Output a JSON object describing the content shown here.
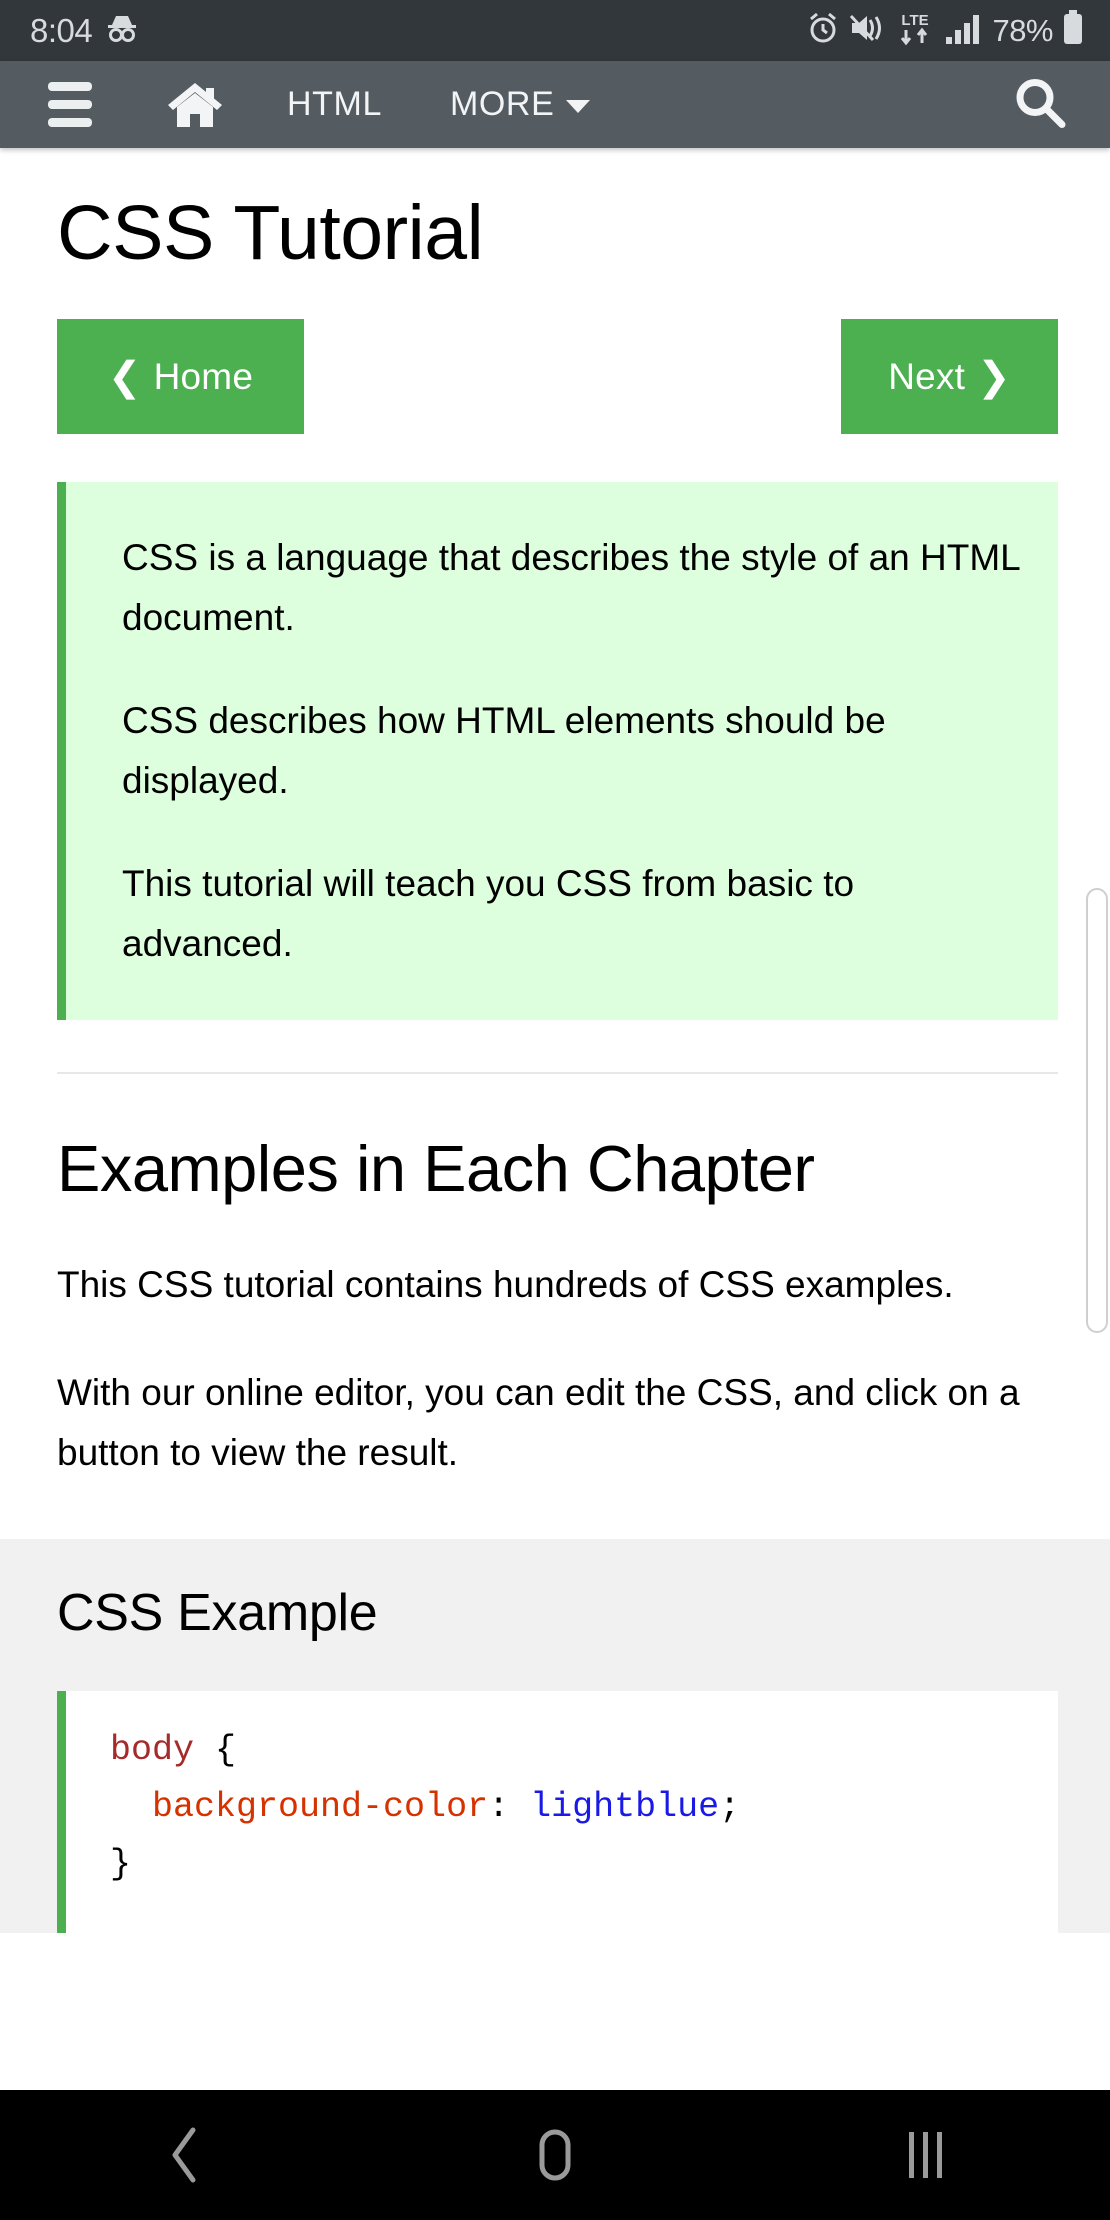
{
  "status_bar": {
    "clock": "8:04",
    "battery_percent": "78%",
    "icons": [
      "incognito-icon",
      "alarm-icon",
      "mute-vibrate-icon",
      "lte-data-icon",
      "signal-bars-icon",
      "battery-icon"
    ],
    "background_color": "#32373b",
    "text_color": "#d8dbdd"
  },
  "topnav": {
    "menu_label": "menu",
    "home_label": "home",
    "html_label": "HTML",
    "more_label": "MORE",
    "search_label": "search",
    "background_color": "#555c61",
    "text_color": "#f2f4f5"
  },
  "page": {
    "title": "CSS Tutorial",
    "prev_button": "Home",
    "prev_chevron": "❮",
    "next_button": "Next",
    "next_chevron": "❯",
    "accent_color": "#4CAF50",
    "notice_background": "#ddffdd",
    "notice_paragraphs": [
      "CSS is a language that describes the style of an HTML document.",
      "CSS describes how HTML elements should be displayed.",
      "This tutorial will teach you CSS from basic to advanced."
    ],
    "section_heading": "Examples in Each Chapter",
    "body_paragraphs": [
      "This CSS tutorial contains hundreds of CSS examples.",
      "With our online editor, you can edit the CSS, and click on a button to view the result."
    ],
    "example_title": "CSS Example",
    "example_panel_background": "#f1f1f1",
    "code": {
      "selector": "body",
      "open_brace": " {",
      "property": "background-color",
      "colon": ": ",
      "value": "lightblue",
      "semicolon": ";",
      "close_brace": "}",
      "selector_color": "#a52a2a",
      "property_color": "#d63200",
      "value_color": "#1a1ae6"
    }
  },
  "android_nav": {
    "back_label": "back",
    "home_label": "home",
    "recents_label": "recent-apps",
    "background_color": "#000000",
    "icon_color": "#9a9a9a"
  }
}
